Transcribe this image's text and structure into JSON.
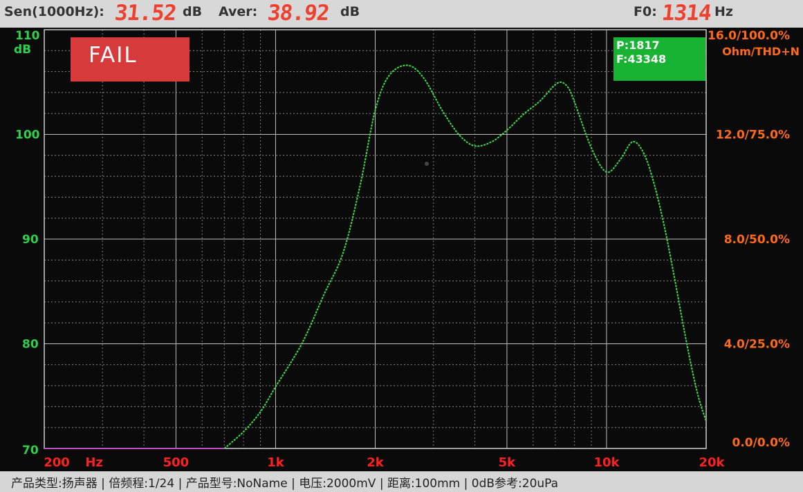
{
  "header": {
    "sen_label": "Sen(1000Hz):",
    "sen_value": "31.52",
    "sen_unit": "dB",
    "aver_label": "Aver:",
    "aver_value": "38.92",
    "aver_unit": "dB",
    "f0_label": "F0:",
    "f0_value": "1314",
    "f0_unit": "Hz"
  },
  "status": {
    "result": "FAIL",
    "pass_count": "P:1817",
    "fail_count": "F:43348"
  },
  "footer": {
    "text": "产品类型:扬声器  |  倍频程:1/24  |  产品型号:NoName  |  电压:2000mV  |  距离:100mm  |  0dB参考:20uPa"
  },
  "colors": {
    "curve": "#3ddc4a",
    "left_axis": "#2fd14a",
    "right_axis": "#ff6a1a",
    "x_axis": "#ff2020",
    "fail_box": "#d73a3a",
    "pf_box": "#19b333"
  },
  "chart_data": {
    "type": "line",
    "x_scale": "log",
    "xlim": [
      200,
      20000
    ],
    "ylim": [
      70,
      110
    ],
    "y2lim_labels": [
      "0.0/0.0%",
      "4.0/25.0%",
      "8.0/50.0%",
      "12.0/75.0%",
      "16.0/100.0%"
    ],
    "y2label": "Ohm/THD+N",
    "ylabel": "dB",
    "y_ticks": [
      {
        "value": 110,
        "label": "110"
      },
      {
        "value": 100,
        "label": "100"
      },
      {
        "value": 90,
        "label": "90"
      },
      {
        "value": 80,
        "label": "80"
      },
      {
        "value": 70,
        "label": "70"
      }
    ],
    "x_ticks": [
      {
        "value": 200,
        "label": "200"
      },
      {
        "value": 500,
        "label": "500"
      },
      {
        "value": 1000,
        "label": "1k"
      },
      {
        "value": 2000,
        "label": "2k"
      },
      {
        "value": 5000,
        "label": "5k"
      },
      {
        "value": 10000,
        "label": "10k"
      },
      {
        "value": 20000,
        "label": "20k"
      }
    ],
    "x_unit_label": "Hz",
    "grid": true,
    "series": [
      {
        "x": [
          700,
          800,
          900,
          1000,
          1200,
          1400,
          1600,
          1800,
          2000,
          2200,
          2500,
          2800,
          3200,
          3600,
          4000,
          4500,
          5000,
          5600,
          6300,
          7100,
          7600,
          8000,
          9000,
          10000,
          11000,
          12000,
          13000,
          14000,
          15000,
          16000,
          17000,
          18000,
          19000,
          20000
        ],
        "y": [
          70.0,
          71.6,
          73.5,
          75.9,
          80.0,
          84.7,
          88.7,
          95.1,
          102.3,
          105.6,
          106.6,
          105.4,
          102.2,
          99.9,
          98.9,
          99.3,
          100.4,
          101.9,
          103.2,
          104.9,
          104.6,
          103.1,
          98.7,
          96.4,
          97.6,
          99.3,
          98.1,
          95.0,
          91.0,
          86.5,
          82.0,
          78.0,
          74.8,
          72.6
        ]
      }
    ]
  }
}
